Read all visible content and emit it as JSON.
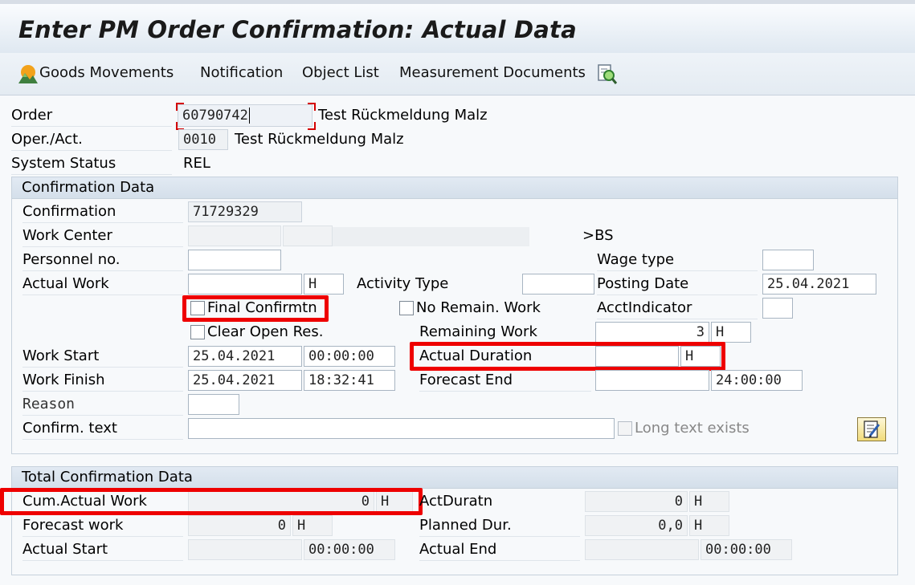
{
  "window": {
    "title": "Enter PM Order Confirmation: Actual Data"
  },
  "toolbar": {
    "goods_movements": "Goods Movements",
    "notification": "Notification",
    "object_list": "Object List",
    "measurement_documents": "Measurement Documents"
  },
  "header": {
    "order_label": "Order",
    "order_value": "60790742",
    "order_desc": "Test Rückmeldung Malz",
    "operact_label": "Oper./Act.",
    "operact_value": "0010",
    "operact_desc": "Test Rückmeldung Malz",
    "status_label": "System Status",
    "status_value": "REL"
  },
  "confirmation": {
    "section_title": "Confirmation Data",
    "confirmation_label": "Confirmation",
    "confirmation_value": "71729329",
    "work_center_label": "Work Center",
    "work_center_suffix": ">BS",
    "personnel_label": "Personnel no.",
    "personnel_value": "",
    "wage_type_label": "Wage type",
    "wage_type_value": "",
    "actual_work_label": "Actual Work",
    "actual_work_value": "",
    "actual_work_unit": "H",
    "activity_type_label": "Activity Type",
    "activity_type_value": "",
    "posting_date_label": "Posting Date",
    "posting_date_value": "25.04.2021",
    "final_confirmation_label": "Final Confirmtn",
    "no_remain_work_label": "No Remain. Work",
    "acct_indicator_label": "AcctIndicator",
    "acct_indicator_value": "",
    "clear_open_res_label": "Clear Open Res.",
    "remaining_work_label": "Remaining Work",
    "remaining_work_value": "3",
    "remaining_work_unit": "H",
    "work_start_label": "Work Start",
    "work_start_date": "25.04.2021",
    "work_start_time": "00:00:00",
    "actual_duration_label": "Actual Duration",
    "actual_duration_value": "",
    "actual_duration_unit": "H",
    "work_finish_label": "Work Finish",
    "work_finish_date": "25.04.2021",
    "work_finish_time": "18:32:41",
    "forecast_end_label": "Forecast End",
    "forecast_end_date": "",
    "forecast_end_time": "24:00:00",
    "reason_label": "Reason",
    "reason_value": "",
    "confirm_text_label": "Confirm. text",
    "confirm_text_value": "",
    "long_text_label": "Long text exists"
  },
  "total": {
    "section_title": "Total Confirmation Data",
    "cum_actual_work_label": "Cum.Actual Work",
    "cum_actual_work_value": "0",
    "cum_actual_work_unit": "H",
    "act_duratn_label": "ActDuratn",
    "act_duratn_value": "0",
    "act_duratn_unit": "H",
    "forecast_work_label": "Forecast work",
    "forecast_work_value": "0",
    "forecast_work_unit": "H",
    "planned_dur_label": "Planned Dur.",
    "planned_dur_value": "0,0",
    "planned_dur_unit": "H",
    "actual_start_label": "Actual Start",
    "actual_start_date": "",
    "actual_start_time": "00:00:00",
    "actual_end_label": "Actual End",
    "actual_end_date": "",
    "actual_end_time": "00:00:00"
  },
  "colors": {
    "highlight": "#ee0000",
    "header_bg": "#dfe8f1",
    "field_border": "#a8b5c2"
  }
}
